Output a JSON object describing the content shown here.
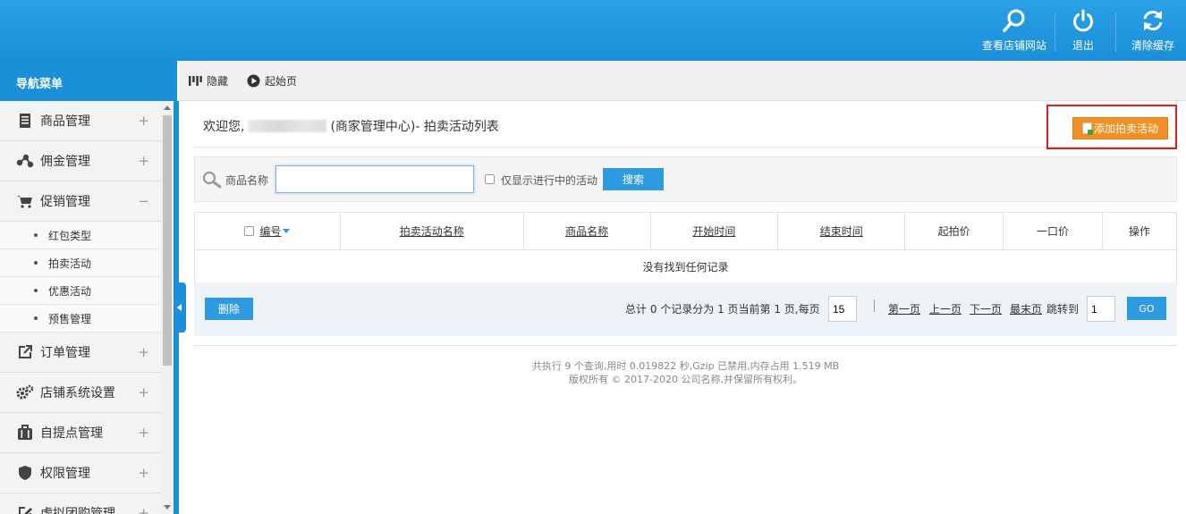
{
  "header": {
    "buttons": [
      {
        "label": "查看店铺网站",
        "icon": "search-icon"
      },
      {
        "label": "退出",
        "icon": "power-icon"
      },
      {
        "label": "清除缓存",
        "icon": "refresh-icon"
      }
    ]
  },
  "sidebar": {
    "title": "导航菜单",
    "items": [
      {
        "label": "商品管理",
        "icon": "document-icon",
        "sign": "+"
      },
      {
        "label": "佣金管理",
        "icon": "share-nodes-icon",
        "sign": "+"
      },
      {
        "label": "促销管理",
        "icon": "cart-icon",
        "sign": "−"
      },
      {
        "label": "订单管理",
        "icon": "external-link-icon",
        "sign": "+"
      },
      {
        "label": "店铺系统设置",
        "icon": "gears-icon",
        "sign": "+"
      },
      {
        "label": "自提点管理",
        "icon": "briefcase-icon",
        "sign": "+"
      },
      {
        "label": "权限管理",
        "icon": "shield-icon",
        "sign": "+"
      },
      {
        "label": "虚拟团购管理",
        "icon": "edit-icon",
        "sign": "+"
      }
    ],
    "subitems": [
      "红包类型",
      "拍卖活动",
      "优惠活动",
      "预售管理"
    ]
  },
  "subbar": {
    "hide_label": "隐藏",
    "home_label": "起始页"
  },
  "page": {
    "welcome_prefix": "欢迎您,",
    "welcome_suffix": "(商家管理中心)- 拍卖活动列表",
    "add_button": "添加拍卖活动"
  },
  "search": {
    "label": "商品名称",
    "value": "",
    "placeholder": "",
    "checkbox_label": "仅显示进行中的活动",
    "button": "搜索"
  },
  "table": {
    "columns": [
      "编号",
      "拍卖活动名称",
      "商品名称",
      "开始时间",
      "结束时间",
      "起拍价",
      "一口价",
      "操作"
    ],
    "empty_text": "没有找到任何记录"
  },
  "pager": {
    "delete_button": "删除",
    "summary": "总计 0 个记录分为 1 页当前第 1 页,每页",
    "per_page": "15",
    "first": "第一页",
    "prev": "上一页",
    "next": "下一页",
    "last": "最末页",
    "jump_label": "跳转到",
    "jump_value": "1",
    "go_button": "GO"
  },
  "footer": {
    "line1": "共执行 9 个查询,用时 0.019822 秒,Gzip 已禁用,内存占用 1.519 MB",
    "line2": "版权所有 © 2017-2020 公司名称,并保留所有权利。"
  },
  "colors": {
    "header_blue": "#1b8fd8",
    "accent_orange": "#f29025",
    "highlight_red": "#e31c1c",
    "button_blue": "#2e9be0"
  }
}
